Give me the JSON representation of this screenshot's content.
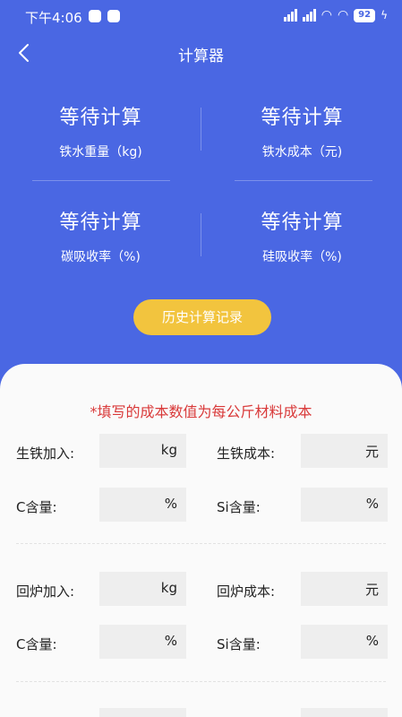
{
  "status_bar": {
    "time": "下午4:06",
    "battery": "92"
  },
  "nav": {
    "title": "计算器"
  },
  "results": [
    {
      "value": "等待计算",
      "label": "铁水重量（kg)"
    },
    {
      "value": "等待计算",
      "label": "铁水成本（元)"
    },
    {
      "value": "等待计算",
      "label": "碳吸收率（%)"
    },
    {
      "value": "等待计算",
      "label": "硅吸收率（%)"
    }
  ],
  "history_button": "历史计算记录",
  "notice": "*填写的成本数值为每公斤材料成本",
  "sections": [
    {
      "rows": [
        [
          {
            "label": "生铁加入:",
            "unit": "kg",
            "value": ""
          },
          {
            "label": "生铁成本:",
            "unit": "元",
            "value": ""
          }
        ],
        [
          {
            "label": "C含量:",
            "unit": "%",
            "value": ""
          },
          {
            "label": "Si含量:",
            "unit": "%",
            "value": ""
          }
        ]
      ]
    },
    {
      "rows": [
        [
          {
            "label": "回炉加入:",
            "unit": "kg",
            "value": ""
          },
          {
            "label": "回炉成本:",
            "unit": "元",
            "value": ""
          }
        ],
        [
          {
            "label": "C含量:",
            "unit": "%",
            "value": ""
          },
          {
            "label": "Si含量:",
            "unit": "%",
            "value": ""
          }
        ]
      ]
    }
  ],
  "colors": {
    "primary": "#4a67e3",
    "accent": "#f2c43e",
    "notice": "#d93a3a"
  }
}
